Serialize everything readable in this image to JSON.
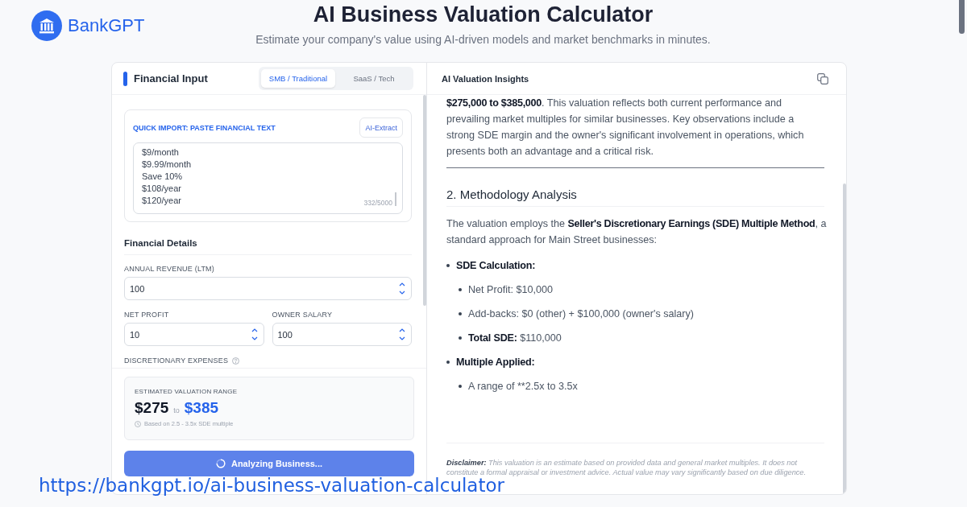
{
  "brand": {
    "name": "BankGPT"
  },
  "header": {
    "title": "AI Business Valuation Calculator",
    "subtitle": "Estimate your company's value using AI-driven models and market benchmarks in minutes."
  },
  "input_panel": {
    "title": "Financial Input",
    "mode_tabs": [
      {
        "label": "SMB / Traditional",
        "selected": true
      },
      {
        "label": "SaaS / Tech",
        "selected": false
      }
    ],
    "quick_import": {
      "label": "QUICK IMPORT: PASTE FINANCIAL TEXT",
      "button": "AI-Extract",
      "value": "$9/month\n$9.99/month\nSave 10%\n$108/year\n$120/year",
      "counter": "332/5000"
    },
    "section_title": "Financial Details",
    "field_rows": [
      {
        "fields": [
          {
            "label": "ANNUAL REVENUE (LTM)",
            "value": "100",
            "help": false
          }
        ]
      },
      {
        "fields": [
          {
            "label": "NET PROFIT",
            "value": "10",
            "help": false
          },
          {
            "label": "OWNER SALARY",
            "value": "100",
            "help": false
          }
        ]
      },
      {
        "fields": [
          {
            "label": "DISCRETIONARY EXPENSES",
            "help": true
          }
        ]
      }
    ],
    "estimate": {
      "label": "ESTIMATED VALUATION RANGE",
      "low": "$275",
      "separator": "to",
      "high": "$385",
      "note": "Based on 2.5 - 3.5x SDE multiple"
    },
    "analyze_button": {
      "label": "Analyzing Business...",
      "busy": true
    }
  },
  "insights_panel": {
    "title": "AI Valuation Insights",
    "intro": "**$275,000 to $385,000**. This valuation reflects both current performance and prevailing market multiples for similar businesses. Key observations include a strong SDE margin and the owner's significant involvement in operations, which presents both an advantage and a critical risk.",
    "section_heading": "2. Methodology Analysis",
    "method_text": "The valuation employs the **Seller's Discretionary Earnings (SDE) Multiple Method**, a standard approach for Main Street businesses:",
    "bullets": [
      {
        "label": "SDE Calculation:",
        "children": [
          {
            "text": "Net Profit: $10,000"
          },
          {
            "text": "Add-backs: $0 (other) + $100,000 (owner's salary)"
          },
          {
            "lead": "Total SDE:",
            "text": "$110,000"
          }
        ]
      },
      {
        "label": "Multiple Applied:",
        "children": [
          {
            "text": "A range of **2.5x to 3.5x"
          }
        ]
      }
    ],
    "disclaimer": "**Disclaimer:** This valuation is an estimate based on provided data and general market multiples. It does not constitute a formal appraisal or investment advice. Actual value may vary significantly based on due diligence."
  },
  "url_caption": "https://bankgpt.io/ai-business-valuation-calculator"
}
